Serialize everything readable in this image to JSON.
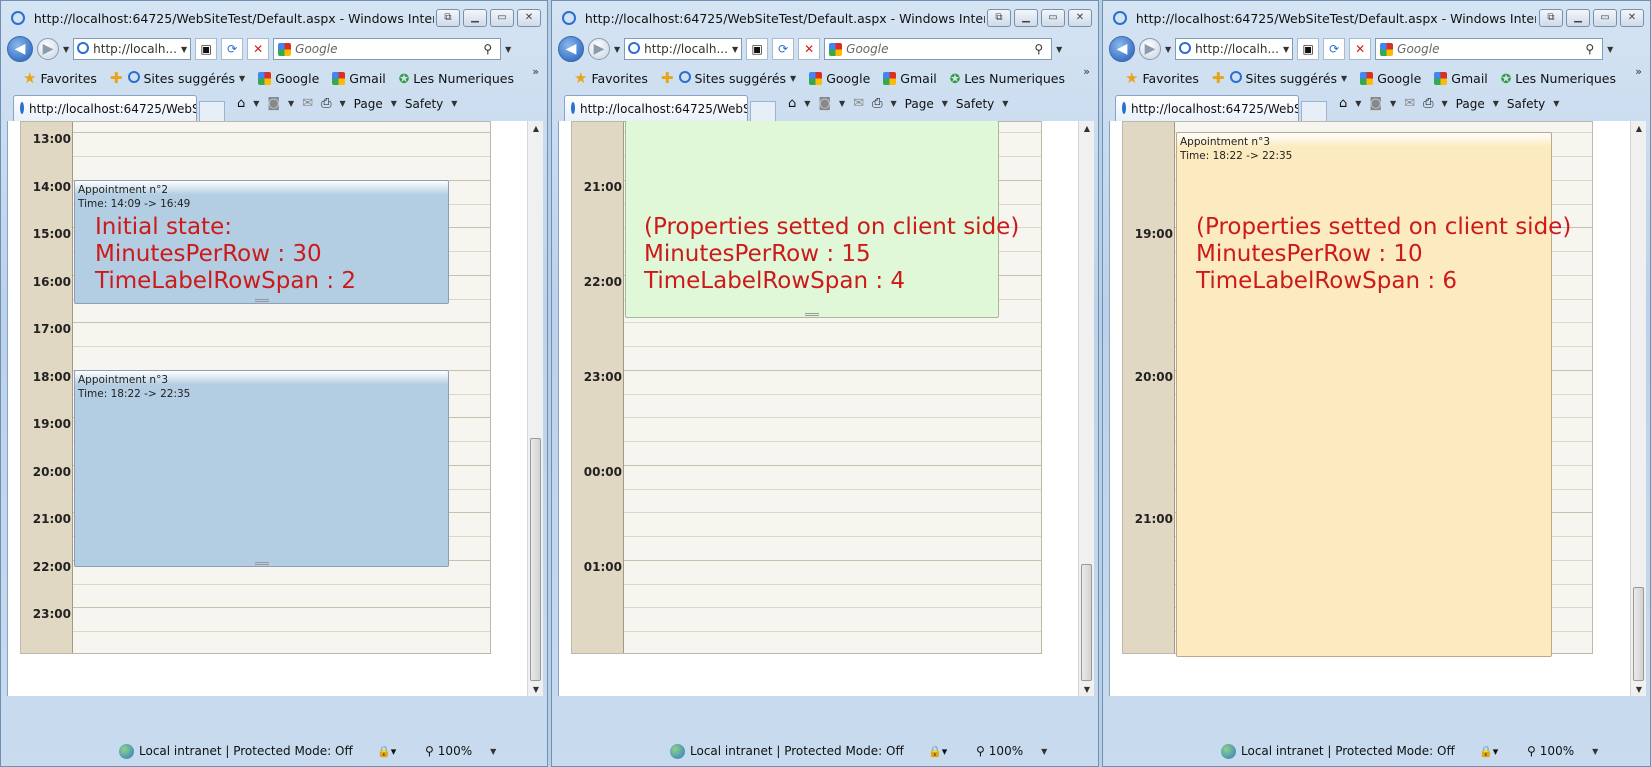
{
  "windows": [
    {
      "title": "http://localhost:64725/WebSiteTest/Default.aspx - Windows Internet Explorer",
      "address": "http://localh...",
      "search_placeholder": "Google",
      "favorites": {
        "favorites_label": "Favorites",
        "items": [
          "Sites suggérés",
          "Google",
          "Gmail",
          "Les Numeriques"
        ]
      },
      "tab_label": "http://localhost:64725/WebS...",
      "cmd": {
        "page": "Page",
        "safety": "Safety"
      },
      "schedule": {
        "hours": [
          "13:00",
          "14:00",
          "15:00",
          "16:00",
          "17:00",
          "18:00",
          "19:00",
          "20:00",
          "21:00",
          "22:00",
          "23:00"
        ],
        "appointments": [
          {
            "title": "Appointment n°2",
            "time": "Time: 14:09 -> 16:49",
            "color": "#b3cde2"
          },
          {
            "title": "Appointment n°3",
            "time": "Time: 18:22 -> 22:35",
            "color": "#b3cde2"
          }
        ]
      },
      "note": [
        "Initial state:",
        "MinutesPerRow : 30",
        "TimeLabelRowSpan : 2"
      ],
      "status": {
        "zone": "Local intranet | Protected Mode: Off",
        "zoom": "100%"
      }
    },
    {
      "title": "http://localhost:64725/WebSiteTest/Default.aspx - Windows Internet Explorer",
      "address": "http://localh...",
      "search_placeholder": "Google",
      "favorites": {
        "favorites_label": "Favorites",
        "items": [
          "Sites suggérés",
          "Google",
          "Gmail",
          "Les Numeriques"
        ]
      },
      "tab_label": "http://localhost:64725/WebS...",
      "cmd": {
        "page": "Page",
        "safety": "Safety"
      },
      "schedule": {
        "hours": [
          "21:00",
          "22:00",
          "23:00",
          "00:00",
          "01:00"
        ],
        "appointments": [
          {
            "title": "",
            "time": "",
            "color": "#e0f8d8"
          }
        ]
      },
      "note": [
        "(Properties setted on client side)",
        "MinutesPerRow : 15",
        "TimeLabelRowSpan : 4"
      ],
      "status": {
        "zone": "Local intranet | Protected Mode: Off",
        "zoom": "100%"
      }
    },
    {
      "title": "http://localhost:64725/WebSiteTest/Default.aspx - Windows Internet Explorer",
      "address": "http://localh...",
      "search_placeholder": "Google",
      "favorites": {
        "favorites_label": "Favorites",
        "items": [
          "Sites suggérés",
          "Google",
          "Gmail",
          "Les Numeriques"
        ]
      },
      "tab_label": "http://localhost:64725/WebS...",
      "cmd": {
        "page": "Page",
        "safety": "Safety"
      },
      "schedule": {
        "hours": [
          "19:00",
          "20:00",
          "21:00"
        ],
        "appointments": [
          {
            "title": "Appointment n°3",
            "time": "Time: 18:22 -> 22:35",
            "color": "#fcebc0"
          }
        ]
      },
      "note": [
        "(Properties setted on client side)",
        "MinutesPerRow : 10",
        "TimeLabelRowSpan : 6"
      ],
      "status": {
        "zone": "Local intranet | Protected Mode: Off",
        "zoom": "100%"
      }
    }
  ]
}
